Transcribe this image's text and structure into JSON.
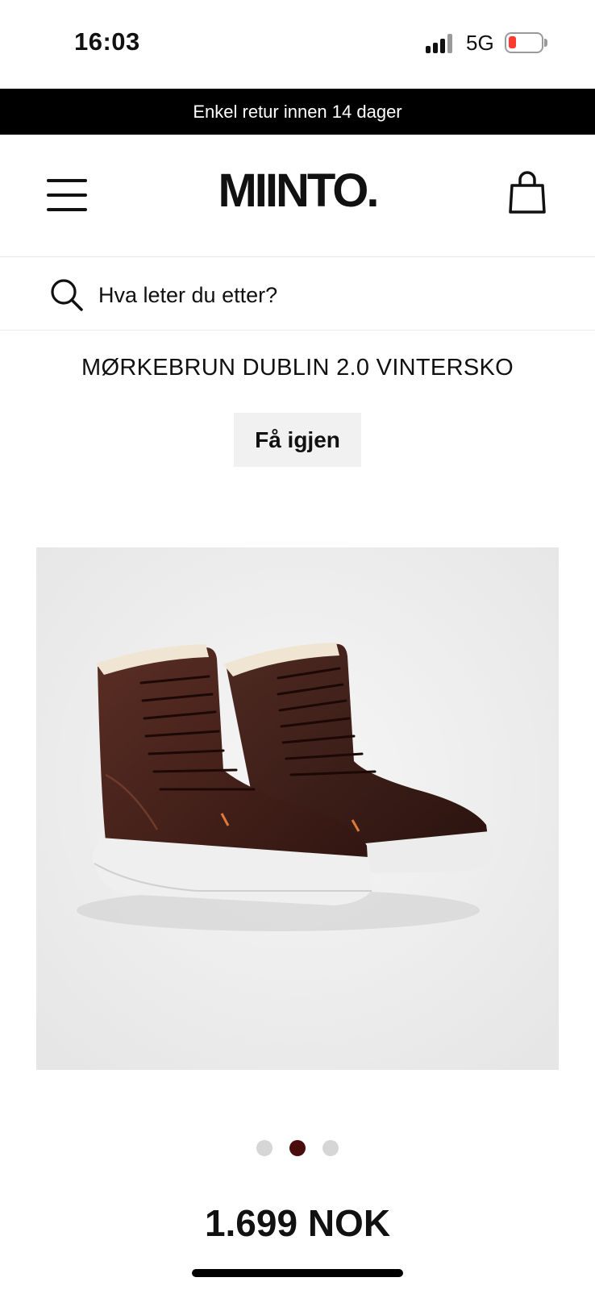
{
  "status_bar": {
    "time": "16:03",
    "network": "5G",
    "battery_color": "#ff3b30",
    "icons": [
      "signal-icon",
      "battery-icon"
    ]
  },
  "promo_banner": {
    "text": "Enkel retur innen 14 dager"
  },
  "header": {
    "logo": "MIINTO.",
    "icons": [
      "hamburger-menu-icon",
      "shopping-bag-icon"
    ]
  },
  "search": {
    "placeholder": "Hva leter du etter?",
    "value": ""
  },
  "product": {
    "title": "MØRKEBRUN DUBLIN 2.0 VINTERSKO",
    "reorder_label": "Få igjen",
    "image_alt": "dark brown lace-up winter boots with white soles",
    "carousel": {
      "total": 3,
      "active_index": 2
    },
    "price": "1.699 NOK"
  },
  "colors": {
    "banner_bg": "#000000",
    "active_dot": "#4a0d0d",
    "inactive_dot": "#d6d6d6",
    "button_bg": "#f1f1f1"
  }
}
